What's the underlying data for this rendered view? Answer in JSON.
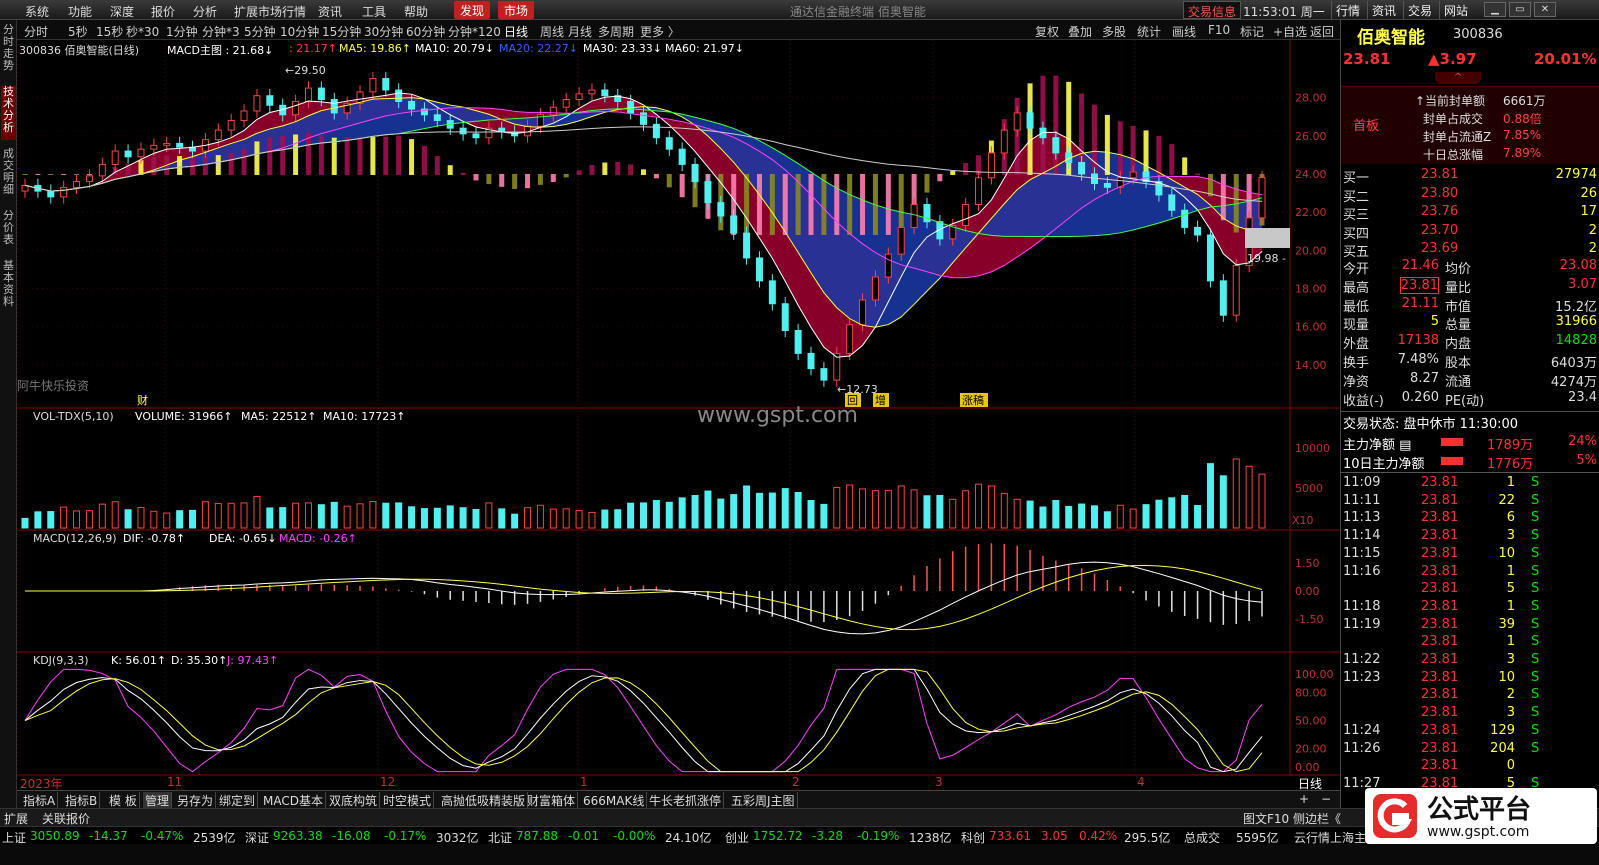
{
  "menu": {
    "items": [
      "系统",
      "功能",
      "深度",
      "报价",
      "分析",
      "扩展市场行情",
      "资讯",
      "工具",
      "帮助"
    ],
    "find": "发现",
    "market": "市场",
    "center_title": "通达信金融终端  佰奥智能",
    "trade_info": "交易信息",
    "clock": "11:53:01 周一",
    "right": [
      "行情",
      "资讯",
      "交易",
      "网站"
    ]
  },
  "toolbar": {
    "periods": [
      "分时",
      "5秒",
      "15秒",
      "秒*30",
      "1分钟",
      "分钟*3",
      "5分钟",
      "10分钟",
      "15分钟",
      "30分钟",
      "60分钟",
      "分钟*120",
      "日线",
      "周线",
      "月线",
      "多周期",
      "更多 〉"
    ],
    "tools": [
      "复权",
      "叠加",
      "多股",
      "统计",
      "画线",
      "F10",
      "标记",
      "+自选",
      "返回"
    ]
  },
  "leftnav": [
    "分时走势",
    "技术分析",
    "成交明细",
    "分价表",
    "基本资料"
  ],
  "main": {
    "header": {
      "code_name": "300836 佰奥智能(日线)",
      "indicator": "MACD主图 : 21.68↓",
      "v1": ": 21.17↑",
      "ma5": "MA5: 19.86↑",
      "ma10": "MA10: 20.79↓",
      "ma20": "MA20: 22.27↓",
      "ma30": "MA30: 23.33↓",
      "ma60": "MA60: 21.97↓"
    },
    "high_label": "29.50",
    "low_label": "12.73",
    "last_label": "19.98",
    "watermark_left": "阿牛快乐投资",
    "watermark_site": "www.gspt.com",
    "marks": [
      "财",
      "回",
      "增",
      "涨稿"
    ],
    "yticks": [
      "28.00",
      "26.00",
      "24.00",
      "22.00",
      "20.00",
      "18.00",
      "16.00",
      "14.00"
    ]
  },
  "chart_data": {
    "type": "candlestick",
    "title": "300836 佰奥智能(日线)",
    "ylim": [
      12.73,
      29.5
    ],
    "x": [
      "2023年",
      "11",
      "12",
      "1",
      "2",
      "3",
      "4"
    ],
    "close": [
      23.4,
      23.1,
      22.8,
      23.3,
      23.6,
      23.9,
      24.5,
      25.2,
      24.9,
      25.3,
      25.5,
      25.6,
      25.4,
      25.2,
      25.8,
      26.3,
      26.8,
      27.3,
      28.1,
      27.6,
      27.1,
      27.8,
      28.5,
      27.9,
      27.2,
      27.7,
      28.3,
      29.0,
      28.4,
      27.8,
      27.4,
      27.1,
      26.8,
      26.4,
      26.1,
      25.9,
      26.4,
      26.2,
      26.0,
      26.5,
      27.1,
      27.5,
      27.9,
      28.2,
      28.4,
      28.1,
      27.8,
      27.2,
      26.6,
      25.9,
      25.3,
      24.5,
      23.6,
      22.5,
      21.8,
      20.9,
      19.6,
      18.4,
      17.2,
      15.8,
      14.6,
      13.8,
      13.2,
      14.6,
      16.1,
      17.4,
      18.6,
      19.8,
      21.2,
      22.4,
      21.5,
      20.6,
      21.3,
      22.4,
      23.8,
      25.1,
      26.3,
      27.2,
      26.4,
      25.9,
      25.1,
      24.6,
      24.0,
      23.5,
      23.3,
      23.8,
      24.1,
      23.6,
      22.9,
      22.1,
      21.2,
      20.8,
      18.4,
      16.6,
      19.2,
      21.7,
      23.81
    ],
    "ma5": [
      19.86
    ],
    "ma10": [
      20.79
    ],
    "ma20": [
      22.27
    ],
    "ma30": [
      23.33
    ],
    "ma60": [
      21.97
    ]
  },
  "volume": {
    "header": {
      "name": "VOL-TDX(5,10)",
      "vol": "VOLUME: 31966↑",
      "ma5": "MA5: 22512↑",
      "ma10": "MA10: 17723↑"
    },
    "yticks": [
      "10000",
      "5000"
    ],
    "unit": "X10"
  },
  "macd": {
    "header": {
      "name": "MACD(12,26,9)",
      "dif": "DIF: -0.78↑",
      "dea": "DEA: -0.65↓",
      "macd": "MACD: -0.26↑"
    },
    "yticks": [
      "1.50",
      "0.00",
      "-1.50"
    ]
  },
  "kdj": {
    "header": {
      "name": "KDJ(9,3,3)",
      "k": "K: 56.01↑",
      "d": "D: 35.30↑",
      "j": "J: 97.43↑"
    },
    "yticks": [
      "100.00",
      "80.00",
      "50.00",
      "20.00",
      "0.00"
    ]
  },
  "xaxis": {
    "labels": [
      "2023年",
      "11",
      "12",
      "1",
      "2",
      "3",
      "4"
    ],
    "mode": "日线"
  },
  "bottom_tabs": [
    "指标A",
    "指标B",
    "模 板",
    "管理",
    "另存为",
    "绑定到",
    "MACD基本",
    "双底构筑",
    "时空模式",
    "高抛低吸精装版",
    "财富箱体",
    "666MAK线",
    "牛长老抓涨停",
    "五彩周J主图"
  ],
  "extbar": {
    "ext": "扩展",
    "linked": "关联报价",
    "right": "图文F10  侧边栏《"
  },
  "status": [
    {
      "name": "上证",
      "val": "3050.89",
      "chg": "-14.37",
      "pct": "-0.47%",
      "amt": "2539亿"
    },
    {
      "name": "深证",
      "val": "9263.38",
      "chg": "-16.08",
      "pct": "-0.17%",
      "amt": "3032亿"
    },
    {
      "name": "北证",
      "val": "787.88",
      "chg": "-0.01",
      "pct": "-0.00%",
      "amt": "24.10亿"
    },
    {
      "name": "创业",
      "val": "1752.72",
      "chg": "-3.28",
      "pct": "-0.19%",
      "amt": "1238亿"
    },
    {
      "name": "科创",
      "val": "733.61",
      "chg": "3.05",
      "pct": "0.42%",
      "amt": "295.5亿"
    }
  ],
  "status_total": {
    "label": "总成交",
    "val": "5595亿",
    "server": "云行情上海主站1"
  },
  "quote": {
    "name": "佰奥智能",
    "code": "300836",
    "price": "23.81",
    "change": "▲3.97",
    "pct": "20.01%",
    "badge": "首板",
    "limit_info": [
      {
        "k": "当前封单额",
        "v": "6661万"
      },
      {
        "k": "封单占成交",
        "v": "0.88倍"
      },
      {
        "k": "封单占流通Z",
        "v": "7.85%"
      },
      {
        "k": "十日总涨幅",
        "v": "7.89%"
      }
    ],
    "bids": [
      {
        "k": "买一",
        "p": "23.81",
        "v": "27974"
      },
      {
        "k": "买二",
        "p": "23.80",
        "v": "26"
      },
      {
        "k": "买三",
        "p": "23.76",
        "v": "17"
      },
      {
        "k": "买四",
        "p": "23.70",
        "v": "2"
      },
      {
        "k": "买五",
        "p": "23.69",
        "v": "2"
      }
    ],
    "stats": [
      {
        "k1": "今开",
        "v1": "21.46",
        "k2": "均价",
        "v2": "23.08"
      },
      {
        "k1": "最高",
        "v1": "23.81",
        "k2": "量比",
        "v2": "3.07"
      },
      {
        "k1": "最低",
        "v1": "21.11",
        "k2": "市值",
        "v2": "15.2亿"
      },
      {
        "k1": "现量",
        "v1": "5",
        "k2": "总量",
        "v2": "31966"
      },
      {
        "k1": "外盘",
        "v1": "17138",
        "k2": "内盘",
        "v2": "14828"
      },
      {
        "k1": "换手",
        "v1": "7.48%",
        "k2": "股本",
        "v2": "6403万"
      },
      {
        "k1": "净资",
        "v1": "8.27",
        "k2": "流通",
        "v2": "4274万"
      },
      {
        "k1": "收益(-)",
        "v1": "0.260",
        "k2": "PE(动)",
        "v2": "23.4"
      }
    ],
    "trade_state": "交易状态: 盘中休市 11:30:00",
    "flows": [
      {
        "k": "主力净额",
        "v": "1789万",
        "p": "24%"
      },
      {
        "k": "10日主力净额",
        "v": "1776万",
        "p": "5%"
      }
    ],
    "ticks": [
      {
        "t": "11:09",
        "p": "23.81",
        "v": "1",
        "s": "S"
      },
      {
        "t": "11:11",
        "p": "23.81",
        "v": "22",
        "s": "S"
      },
      {
        "t": "11:13",
        "p": "23.81",
        "v": "6",
        "s": "S"
      },
      {
        "t": "11:14",
        "p": "23.81",
        "v": "3",
        "s": "S"
      },
      {
        "t": "11:15",
        "p": "23.81",
        "v": "10",
        "s": "S"
      },
      {
        "t": "11:16",
        "p": "23.81",
        "v": "1",
        "s": "S"
      },
      {
        "t": "",
        "p": "23.81",
        "v": "5",
        "s": "S"
      },
      {
        "t": "11:18",
        "p": "23.81",
        "v": "1",
        "s": "S"
      },
      {
        "t": "11:19",
        "p": "23.81",
        "v": "39",
        "s": "S"
      },
      {
        "t": "",
        "p": "23.81",
        "v": "1",
        "s": "S"
      },
      {
        "t": "11:22",
        "p": "23.81",
        "v": "3",
        "s": "S"
      },
      {
        "t": "11:23",
        "p": "23.81",
        "v": "10",
        "s": "S"
      },
      {
        "t": "",
        "p": "23.81",
        "v": "2",
        "s": "S"
      },
      {
        "t": "",
        "p": "23.81",
        "v": "3",
        "s": "S"
      },
      {
        "t": "11:24",
        "p": "23.81",
        "v": "129",
        "s": "S"
      },
      {
        "t": "11:26",
        "p": "23.81",
        "v": "204",
        "s": "S"
      },
      {
        "t": "",
        "p": "23.81",
        "v": "0",
        "s": ""
      },
      {
        "t": "11:27",
        "p": "23.81",
        "v": "5",
        "s": "S"
      }
    ]
  },
  "logo": {
    "text": "公式平台",
    "url": "www.gspt.com"
  }
}
